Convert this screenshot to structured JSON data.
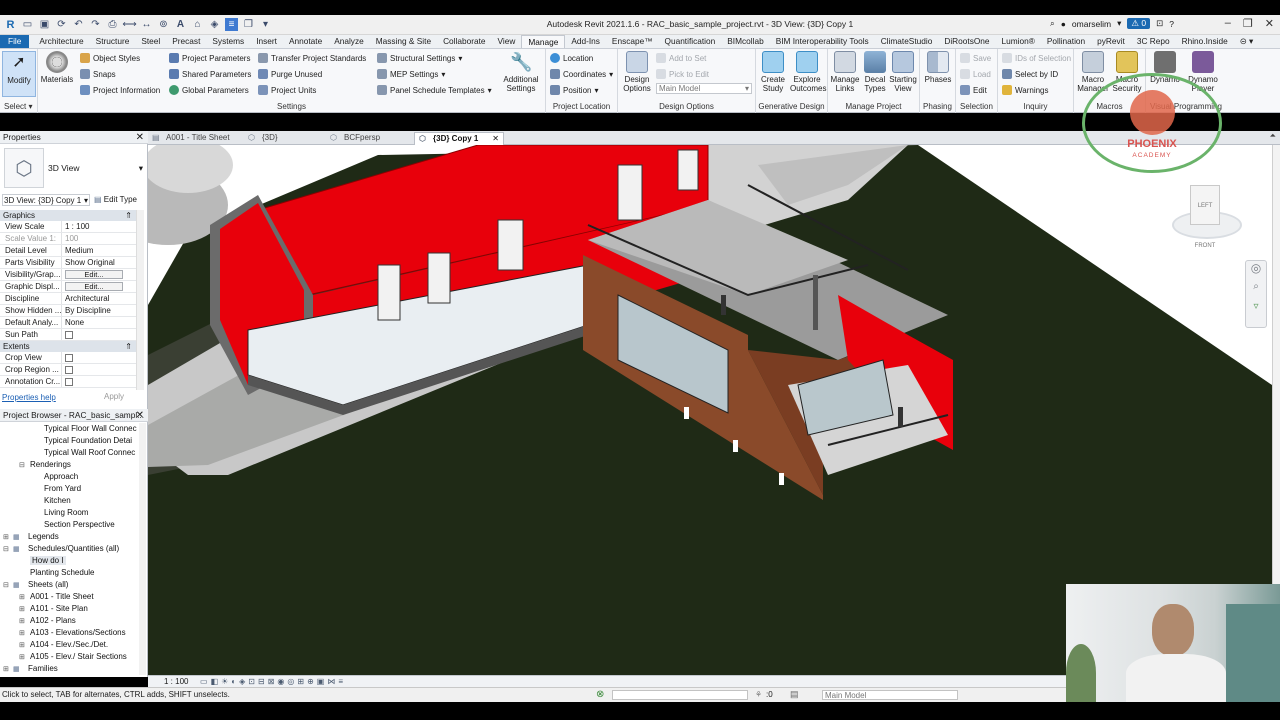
{
  "app": {
    "title": "Autodesk Revit 2021.1.6 - RAC_basic_sample_project.rvt - 3D View: {3D} Copy 1",
    "user": "omarselim",
    "notify_count": "0"
  },
  "ribbon_tabs": [
    "File",
    "Architecture",
    "Structure",
    "Steel",
    "Precast",
    "Systems",
    "Insert",
    "Annotate",
    "Analyze",
    "Massing & Site",
    "Collaborate",
    "View",
    "Manage",
    "Add-Ins",
    "Enscape™",
    "Quantification",
    "BIMcollab",
    "BIM Interoperability Tools",
    "ClimateStudio",
    "DiRootsOne",
    "Lumion®",
    "Pollination",
    "pyRevit",
    "3C Repo",
    "Rhino.Inside"
  ],
  "ribbon": {
    "modify": "Modify",
    "select": "Select",
    "materials": "Materials",
    "settings": {
      "object_styles": "Object Styles",
      "snaps": "Snaps",
      "project_information": "Project  Information",
      "project_parameters": "Project Parameters",
      "shared_parameters": "Shared Parameters",
      "global_parameters": "Global Parameters",
      "transfer_project_standards": "Transfer Project Standards",
      "purge_unused": "Purge Unused",
      "project_units": "Project Units",
      "structural_settings": "Structural  Settings",
      "mep_settings": "MEP  Settings",
      "panel_schedule_templates": "Panel Schedule  Templates",
      "additional_settings": "Additional Settings",
      "label": "Settings"
    },
    "project_location": {
      "location": "Location",
      "coordinates": "Coordinates",
      "position": "Position",
      "label": "Project Location"
    },
    "design_options": {
      "design_options": "Design Options",
      "add_to_set": "Add to Set",
      "pick_to_edit": "Pick to Edit",
      "main_model": "Main Model",
      "label": "Design Options"
    },
    "generative": {
      "create_study": "Create Study",
      "explore_outcomes": "Explore Outcomes",
      "label": "Generative Design"
    },
    "manage_project": {
      "manage_links": "Manage Links",
      "decal_types": "Decal Types",
      "starting_view": "Starting View",
      "label": "Manage Project"
    },
    "phasing": {
      "phases": "Phases",
      "label": "Phasing"
    },
    "selection": {
      "save": "Save",
      "load": "Load",
      "edit": "Edit",
      "label": "Selection"
    },
    "inquiry": {
      "ids_of_selection": "IDs of Selection",
      "select_by_id": "Select  by ID",
      "warnings": "Warnings",
      "label": "Inquiry"
    },
    "macros": {
      "macro_manager": "Macro Manager",
      "macro_security": "Macro Security",
      "label": "Macros"
    },
    "visual_programming": {
      "dynamo": "Dynamo",
      "dynamo_player": "Dynamo Player",
      "label": "Visual Programming"
    }
  },
  "properties": {
    "title": "Properties",
    "type_name": "3D View",
    "selector": "3D View: {3D} Copy 1",
    "edit_type": "Edit Type",
    "groups": [
      {
        "name": "Graphics",
        "rows": [
          {
            "k": "View Scale",
            "v": "1 : 100"
          },
          {
            "k": "Scale Value   1:",
            "v": "100"
          },
          {
            "k": "Detail Level",
            "v": "Medium"
          },
          {
            "k": "Parts Visibility",
            "v": "Show Original"
          },
          {
            "k": "Visibility/Grap...",
            "v": "Edit..."
          },
          {
            "k": "Graphic Displ...",
            "v": "Edit..."
          },
          {
            "k": "Discipline",
            "v": "Architectural"
          },
          {
            "k": "Show Hidden ...",
            "v": "By Discipline"
          },
          {
            "k": "Default Analy...",
            "v": "None"
          },
          {
            "k": "Sun Path",
            "v": ""
          }
        ]
      },
      {
        "name": "Extents",
        "rows": [
          {
            "k": "Crop View",
            "v": ""
          },
          {
            "k": "Crop Region ...",
            "v": ""
          },
          {
            "k": "Annotation Cr...",
            "v": ""
          }
        ]
      }
    ],
    "help": "Properties help",
    "apply": "Apply"
  },
  "browser": {
    "title": "Project Browser - RAC_basic_sampl...",
    "items": [
      {
        "t": "Typical Floor Wall Connec",
        "lvl": 3
      },
      {
        "t": "Typical Foundation Detai",
        "lvl": 3
      },
      {
        "t": "Typical Wall Roof Connec",
        "lvl": 3
      },
      {
        "t": "Renderings",
        "lvl": 2,
        "tw": "−"
      },
      {
        "t": "Approach",
        "lvl": 3
      },
      {
        "t": "From Yard",
        "lvl": 3
      },
      {
        "t": "Kitchen",
        "lvl": 3
      },
      {
        "t": "Living Room",
        "lvl": 3
      },
      {
        "t": "Section Perspective",
        "lvl": 3
      },
      {
        "t": "Legends",
        "lvl": 1,
        "tw": "+"
      },
      {
        "t": "Schedules/Quantities (all)",
        "lvl": 1,
        "tw": "−"
      },
      {
        "t": "How do I",
        "lvl": 2,
        "sel": true
      },
      {
        "t": "Planting Schedule",
        "lvl": 2
      },
      {
        "t": "Sheets (all)",
        "lvl": 1,
        "tw": "−"
      },
      {
        "t": "A001 - Title Sheet",
        "lvl": 2,
        "tw": "+"
      },
      {
        "t": "A101 - Site Plan",
        "lvl": 2,
        "tw": "+"
      },
      {
        "t": "A102 - Plans",
        "lvl": 2,
        "tw": "+"
      },
      {
        "t": "A103 - Elevations/Sections",
        "lvl": 2,
        "tw": "+"
      },
      {
        "t": "A104 - Elev./Sec./Det.",
        "lvl": 2,
        "tw": "+"
      },
      {
        "t": "A105 - Elev./ Stair Sections",
        "lvl": 2,
        "tw": "+"
      },
      {
        "t": "Families",
        "lvl": 1,
        "tw": "+"
      }
    ]
  },
  "view_tabs": [
    {
      "label": "A001 - Title Sheet"
    },
    {
      "label": "{3D}"
    },
    {
      "label": "BCFpersp"
    },
    {
      "label": "{3D} Copy 1",
      "active": true
    }
  ],
  "viewcube": {
    "left": "LEFT",
    "front": "FRONT"
  },
  "view_bar": {
    "scale": "1 : 100"
  },
  "status": {
    "hint": "Click to select, TAB for alternates, CTRL adds, SHIFT unselects.",
    "count": ":0",
    "model": "Main Model"
  },
  "watermark": {
    "brand": "PHOENIX",
    "sub": "ACADEMY"
  },
  "colors": {
    "accent": "#1b6ab2",
    "roof_red": "#e8000b",
    "ground": "#1f2a16"
  }
}
